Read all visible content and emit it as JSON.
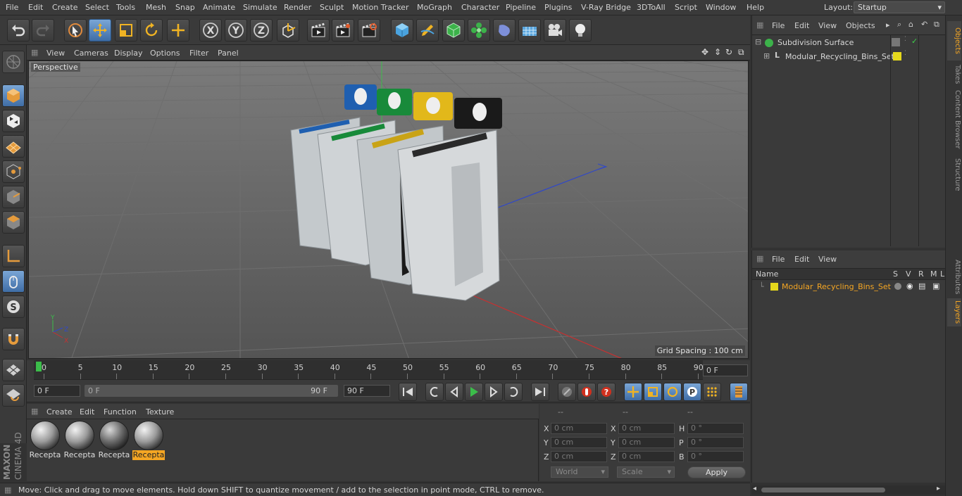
{
  "menubar": {
    "items": [
      "File",
      "Edit",
      "Create",
      "Select",
      "Tools",
      "Mesh",
      "Snap",
      "Animate",
      "Simulate",
      "Render",
      "Sculpt",
      "Motion Tracker",
      "MoGraph",
      "Character",
      "Pipeline",
      "Plugins",
      "V-Ray Bridge",
      "3DToAll",
      "Script",
      "Window",
      "Help"
    ],
    "layout_label": "Layout:",
    "layout_value": "Startup"
  },
  "toolbar": {
    "icons": [
      "undo-icon",
      "redo-icon",
      "select-icon",
      "move-icon",
      "scale-icon",
      "rotate-icon",
      "live-selection-icon",
      "x-axis-icon",
      "y-axis-icon",
      "z-axis-icon",
      "coordinate-system-icon",
      "render-view-icon",
      "render-picture-viewer-icon",
      "render-settings-icon",
      "cube-icon",
      "pen-icon",
      "subdivision-icon",
      "cloner-icon",
      "deformer-icon",
      "floor-icon",
      "camera-icon",
      "light-icon"
    ],
    "axis_labels": [
      "X",
      "Y",
      "Z"
    ]
  },
  "viewport": {
    "menu": [
      "View",
      "Cameras",
      "Display",
      "Options",
      "Filter",
      "Panel"
    ],
    "label": "Perspective",
    "grid_spacing": "Grid Spacing : 100 cm",
    "axis_labels": [
      "Y",
      "Z",
      "X"
    ]
  },
  "timeline": {
    "ticks": [
      "0",
      "5",
      "10",
      "15",
      "20",
      "25",
      "30",
      "35",
      "40",
      "45",
      "50",
      "55",
      "60",
      "65",
      "70",
      "75",
      "80",
      "85",
      "90"
    ],
    "current_frame": "0 F",
    "start_field": "0 F",
    "range_start": "0 F",
    "range_end": "90 F",
    "end_field": "90 F"
  },
  "materials": {
    "menu": [
      "Create",
      "Edit",
      "Function",
      "Texture"
    ],
    "items": [
      {
        "label": "Recepta",
        "selected": false
      },
      {
        "label": "Recepta",
        "selected": false
      },
      {
        "label": "Recepta",
        "selected": false
      },
      {
        "label": "Recepta",
        "selected": true
      }
    ]
  },
  "coordinates": {
    "headers": [
      "--",
      "--",
      "--"
    ],
    "rows": [
      {
        "a": "X",
        "av": "0 cm",
        "b": "X",
        "bv": "0 cm",
        "c": "H",
        "cv": "0 °"
      },
      {
        "a": "Y",
        "av": "0 cm",
        "b": "Y",
        "bv": "0 cm",
        "c": "P",
        "cv": "0 °"
      },
      {
        "a": "Z",
        "av": "0 cm",
        "b": "Z",
        "bv": "0 cm",
        "c": "B",
        "cv": "0 °"
      }
    ],
    "mode": "World",
    "size_mode": "Scale",
    "apply": "Apply"
  },
  "status": "Move: Click and drag to move elements. Hold down SHIFT to quantize movement / add to the selection in point mode, CTRL to remove.",
  "branding": {
    "maxon": "MAXON",
    "product": "CINEMA 4D"
  },
  "objects": {
    "menu": [
      "File",
      "Edit",
      "View",
      "Objects"
    ],
    "items": [
      {
        "name": "Subdivision Surface"
      },
      {
        "name": "Modular_Recycling_Bins_Set"
      }
    ]
  },
  "layers": {
    "menu": [
      "File",
      "Edit",
      "View"
    ],
    "headers": {
      "name": "Name",
      "s": "S",
      "v": "V",
      "r": "R",
      "m": "M",
      "l": "L"
    },
    "item": "Modular_Recycling_Bins_Set",
    "accent": "#f5a623"
  },
  "right_tabs": [
    "Objects",
    "Takes",
    "Content Browser",
    "Structure",
    "Attributes",
    "Layers"
  ]
}
